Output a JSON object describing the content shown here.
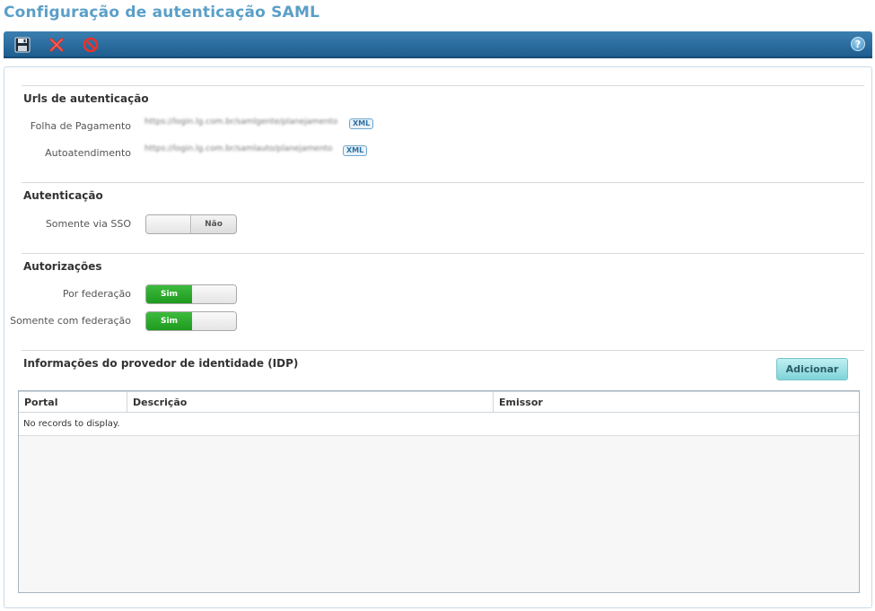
{
  "page": {
    "title": "Configuração de autenticação SAML"
  },
  "toolbar": {
    "save_icon": "floppy-disk-icon",
    "cancel_icon": "red-x-icon",
    "block_icon": "no-entry-icon",
    "help_label": "?"
  },
  "urls": {
    "title": "Urls de autenticação",
    "items": [
      {
        "label": "Folha de Pagamento",
        "url": "https://login.lg.com.br/samlgente/planejamento",
        "badge": "XML"
      },
      {
        "label": "Autoatendimento",
        "url": "https://login.lg.com.br/samlauto/planejamento",
        "badge": "XML"
      }
    ]
  },
  "auth": {
    "title": "Autenticação",
    "sso_label": "Somente via SSO",
    "sso_value": "Não"
  },
  "authz": {
    "title": "Autorizações",
    "items": [
      {
        "label": "Por federação",
        "value": "Sim"
      },
      {
        "label": "Somente com federação",
        "value": "Sim"
      }
    ]
  },
  "idp": {
    "title": "Informações do provedor de identidade (IDP)",
    "add_label": "Adicionar",
    "columns": [
      "Portal",
      "Descrição",
      "Emissor"
    ],
    "empty_text": "No records to display."
  },
  "colors": {
    "accent": "#5a9fc8",
    "toolbar": "#2a6a9c",
    "toggle_on": "#2aa52a"
  }
}
